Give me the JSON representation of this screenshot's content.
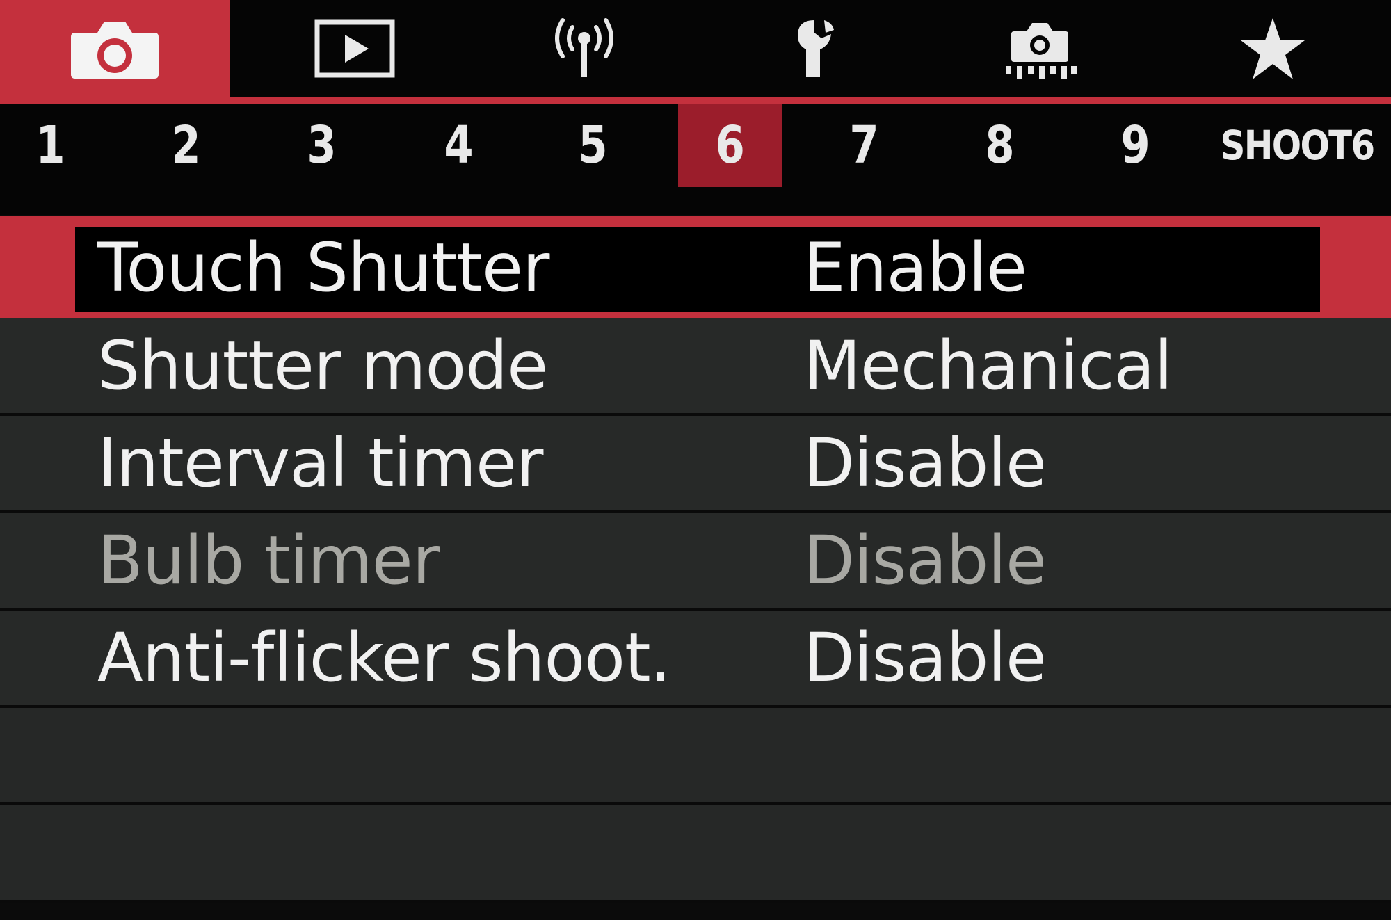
{
  "categories": [
    {
      "name": "shooting",
      "icon": "camera-icon",
      "active": true
    },
    {
      "name": "playback",
      "icon": "playback-icon",
      "active": false
    },
    {
      "name": "wireless",
      "icon": "wireless-icon",
      "active": false
    },
    {
      "name": "setup",
      "icon": "wrench-icon",
      "active": false
    },
    {
      "name": "custom-functions",
      "icon": "camera-dots-icon",
      "active": false
    },
    {
      "name": "my-menu",
      "icon": "star-icon",
      "active": false
    }
  ],
  "pages": {
    "tabs": [
      "1",
      "2",
      "3",
      "4",
      "5",
      "6",
      "7",
      "8",
      "9"
    ],
    "active_index": 5,
    "current_name": "SHOOT6"
  },
  "menu": {
    "items": [
      {
        "label": "Touch Shutter",
        "value": "Enable",
        "selected": true,
        "enabled": true
      },
      {
        "label": "Shutter mode",
        "value": "Mechanical",
        "selected": false,
        "enabled": true
      },
      {
        "label": "Interval timer",
        "value": "Disable",
        "selected": false,
        "enabled": true
      },
      {
        "label": "Bulb timer",
        "value": "Disable",
        "selected": false,
        "enabled": false
      },
      {
        "label": "Anti-flicker shoot.",
        "value": "Disable",
        "selected": false,
        "enabled": true
      }
    ]
  },
  "colors": {
    "accent": "#c4303d",
    "active_page": "#9b1d2b",
    "row_bg": "#272928",
    "text": "#f1f1f1",
    "disabled_text": "#a8a8a3"
  }
}
